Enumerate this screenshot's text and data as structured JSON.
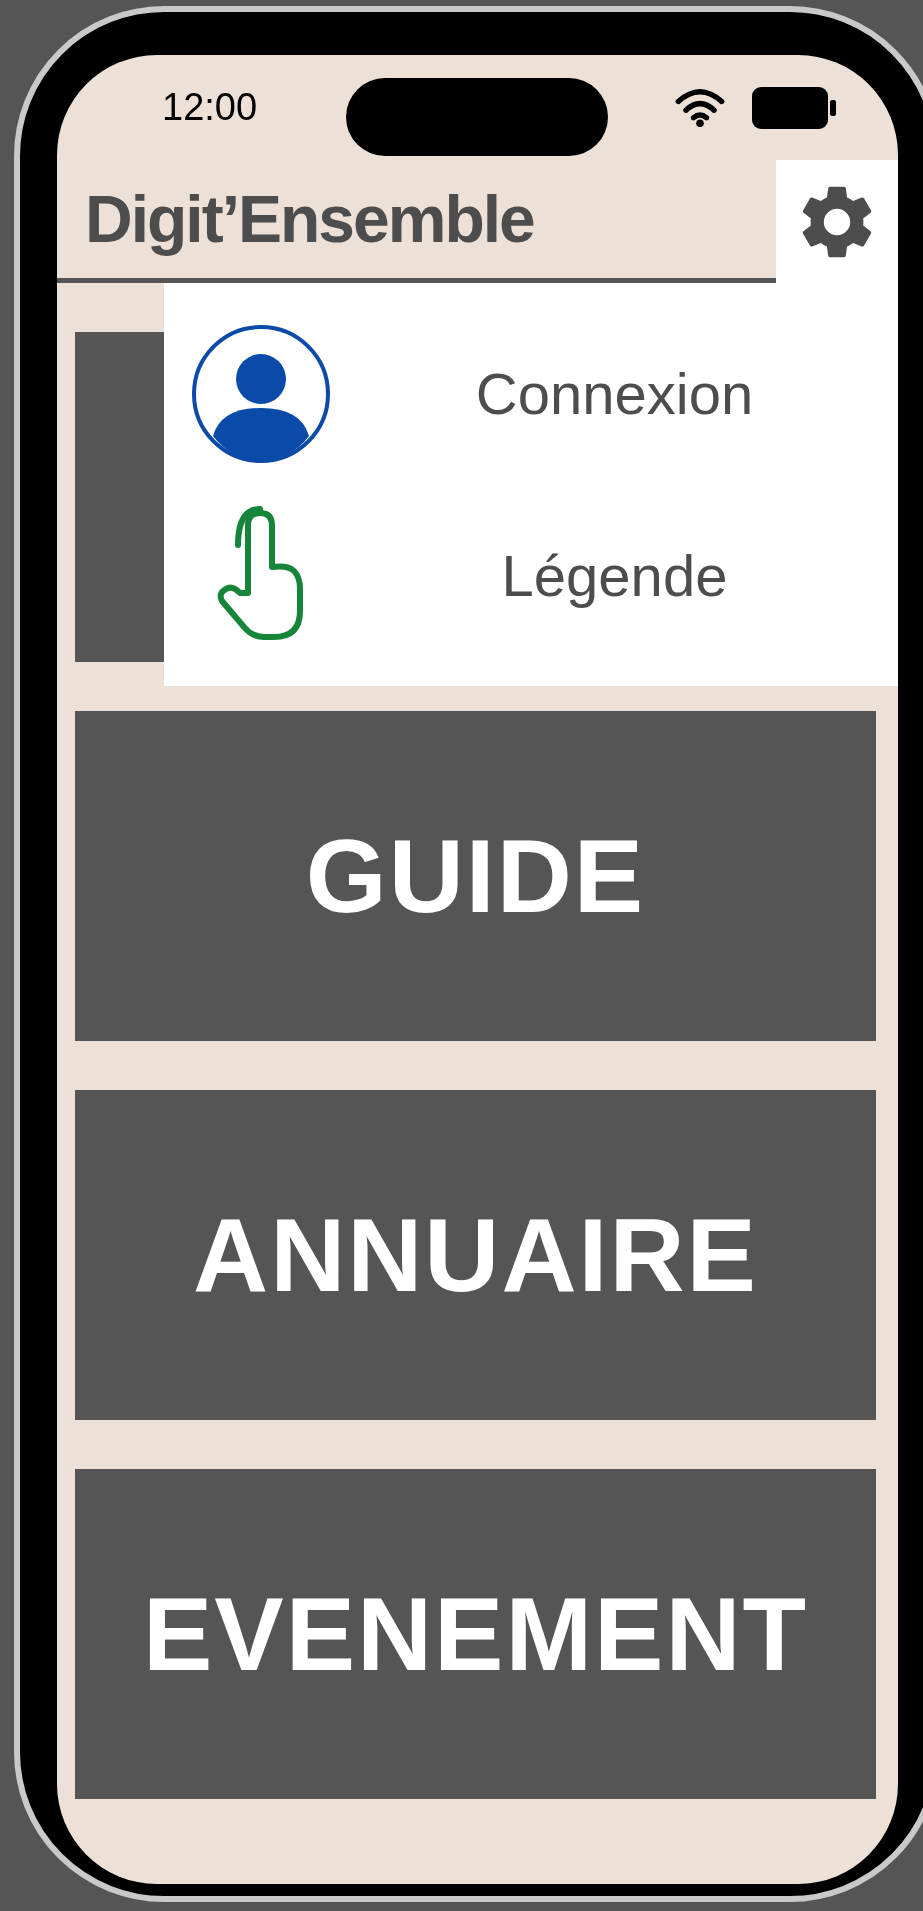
{
  "status_bar": {
    "time": "12:00"
  },
  "header": {
    "title": "Digit’Ensemble"
  },
  "settings_menu": {
    "open": true,
    "items": [
      {
        "kind": "account",
        "label": "Connexion"
      },
      {
        "kind": "legend",
        "label": "Légende"
      }
    ]
  },
  "tiles": [
    {
      "label": "GUIDE"
    },
    {
      "label": "ANNUAIRE"
    },
    {
      "label": "EVENEMENT"
    }
  ]
}
